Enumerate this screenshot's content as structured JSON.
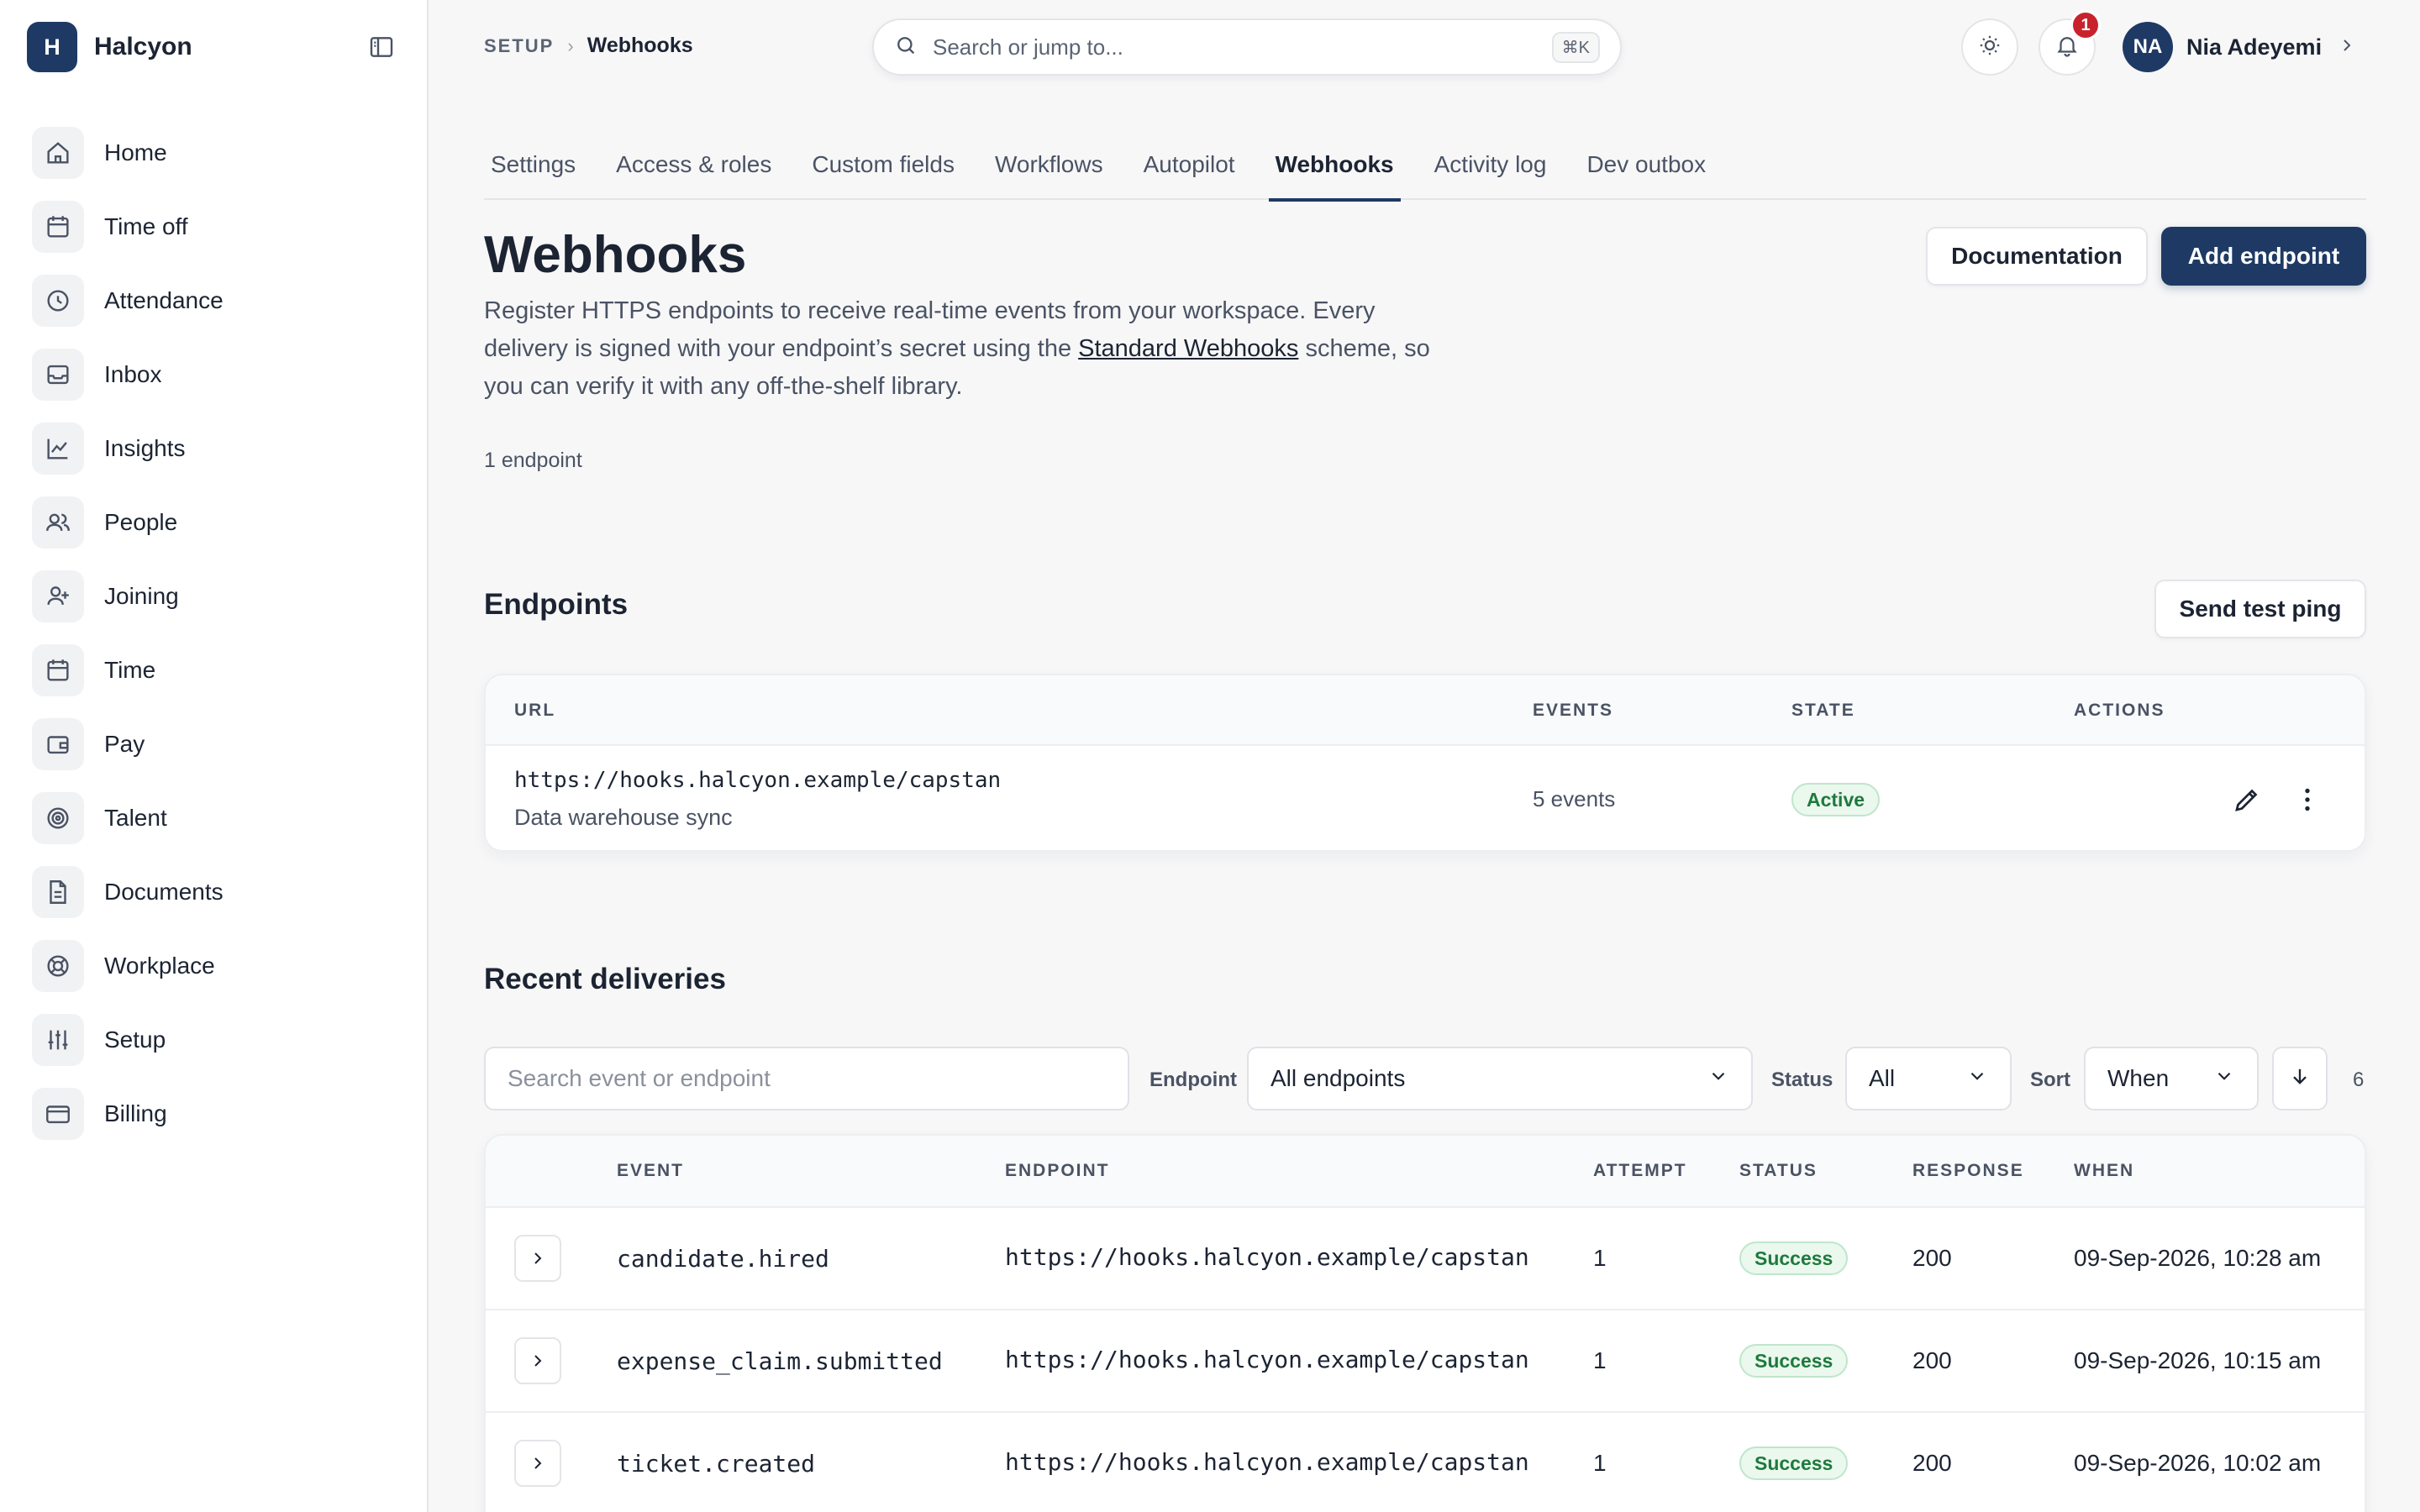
{
  "brand": {
    "logo_letter": "H",
    "name": "Halcyon"
  },
  "sidebar": {
    "items": [
      {
        "label": "Home",
        "icon": "home-icon"
      },
      {
        "label": "Time off",
        "icon": "calendar-icon"
      },
      {
        "label": "Attendance",
        "icon": "clock-icon"
      },
      {
        "label": "Inbox",
        "icon": "inbox-icon"
      },
      {
        "label": "Insights",
        "icon": "chart-line-icon"
      },
      {
        "label": "People",
        "icon": "users-icon"
      },
      {
        "label": "Joining",
        "icon": "user-plus-icon"
      },
      {
        "label": "Time",
        "icon": "calendar-icon"
      },
      {
        "label": "Pay",
        "icon": "wallet-icon"
      },
      {
        "label": "Talent",
        "icon": "target-icon"
      },
      {
        "label": "Documents",
        "icon": "document-icon"
      },
      {
        "label": "Workplace",
        "icon": "lifebuoy-icon"
      },
      {
        "label": "Setup",
        "icon": "sliders-icon"
      },
      {
        "label": "Billing",
        "icon": "credit-card-icon"
      }
    ]
  },
  "breadcrumb": {
    "root": "SETUP",
    "current": "Webhooks"
  },
  "search": {
    "placeholder": "Search or jump to...",
    "shortcut": "⌘K"
  },
  "notifications": {
    "count": "1"
  },
  "user": {
    "initials": "NA",
    "name": "Nia Adeyemi"
  },
  "tabs": [
    {
      "label": "Settings",
      "active": false
    },
    {
      "label": "Access & roles",
      "active": false
    },
    {
      "label": "Custom fields",
      "active": false
    },
    {
      "label": "Workflows",
      "active": false
    },
    {
      "label": "Autopilot",
      "active": false
    },
    {
      "label": "Webhooks",
      "active": true
    },
    {
      "label": "Activity log",
      "active": false
    },
    {
      "label": "Dev outbox",
      "active": false
    }
  ],
  "header": {
    "title": "Webhooks",
    "desc_before": "Register HTTPS endpoints to receive real-time events from your workspace. Every delivery is signed with your endpoint’s secret using the ",
    "desc_link": "Standard Webhooks",
    "desc_after": " scheme, so you can verify it with any off-the-shelf library.",
    "endpoint_count": "1 endpoint",
    "documentation_label": "Documentation",
    "add_endpoint_label": "Add endpoint"
  },
  "endpoints": {
    "title": "Endpoints",
    "send_test_label": "Send test ping",
    "columns": {
      "url": "URL",
      "events": "EVENTS",
      "state": "STATE",
      "actions": "ACTIONS"
    },
    "rows": [
      {
        "url": "https://hooks.halcyon.example/capstan",
        "description": "Data warehouse sync",
        "events": "5 events",
        "state": "Active"
      }
    ]
  },
  "deliveries": {
    "title": "Recent deliveries",
    "search_placeholder": "Search event or endpoint",
    "endpoint_filter_label": "Endpoint",
    "endpoint_filter_value": "All endpoints",
    "status_filter_label": "Status",
    "status_filter_value": "All",
    "sort_label": "Sort",
    "sort_value": "When",
    "count": "6",
    "columns": {
      "event": "EVENT",
      "endpoint": "ENDPOINT",
      "attempt": "ATTEMPT",
      "status": "STATUS",
      "response": "RESPONSE",
      "when": "WHEN"
    },
    "rows": [
      {
        "event": "candidate.hired",
        "endpoint": "https://hooks.halcyon.example/capstan",
        "attempt": "1",
        "status": "Success",
        "response": "200",
        "when": "09-Sep-2026, 10:28 am"
      },
      {
        "event": "expense_claim.submitted",
        "endpoint": "https://hooks.halcyon.example/capstan",
        "attempt": "1",
        "status": "Success",
        "response": "200",
        "when": "09-Sep-2026, 10:15 am"
      },
      {
        "event": "ticket.created",
        "endpoint": "https://hooks.halcyon.example/capstan",
        "attempt": "1",
        "status": "Success",
        "response": "200",
        "when": "09-Sep-2026, 10:02 am"
      }
    ]
  },
  "colors": {
    "brand": "#1e3a64",
    "success": "#1e7a3c",
    "badge": "#c8232c"
  }
}
